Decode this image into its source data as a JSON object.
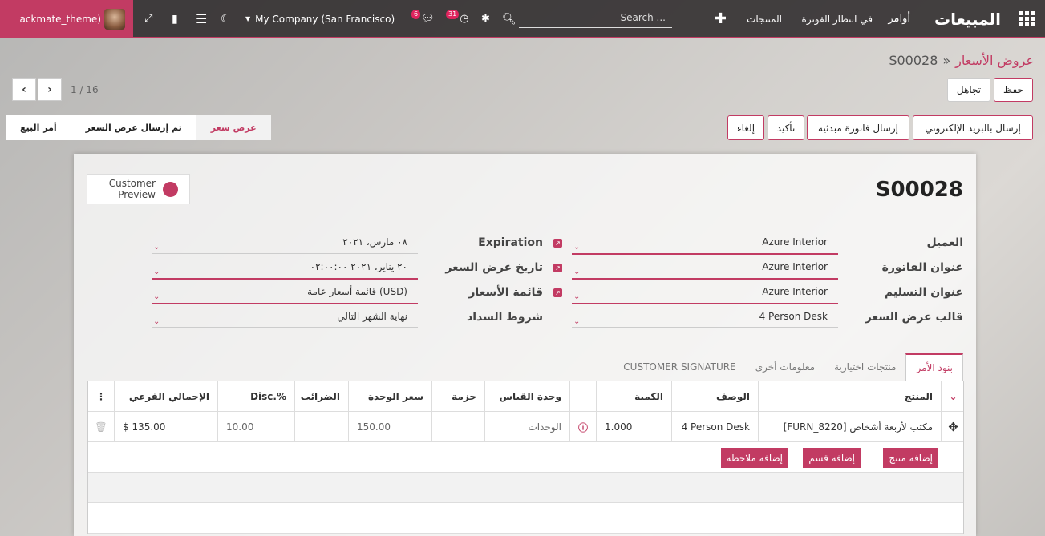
{
  "topbar": {
    "app_title": "المبيعات",
    "menu": [
      "أوامر",
      "في انتظار الفوترة",
      "المنتجات"
    ],
    "search_placeholder": "Search ...",
    "activity_count": "31",
    "chat_count": "6",
    "company": "My Company (San Francisco)",
    "username": "ackmate_theme)"
  },
  "breadcrumb": {
    "parent": "عروض الأسعار",
    "sep": "»",
    "current": "S00028"
  },
  "buttons": {
    "save": "حفظ",
    "discard": "تجاهل"
  },
  "pager": {
    "text": "1 / 16"
  },
  "actions": {
    "email": "إرسال بالبريد الإلكتروني",
    "proforma": "إرسال فاتورة مبدئية",
    "confirm": "تأكيد",
    "cancel": "إلغاء"
  },
  "stages": [
    "أمر البيع",
    "تم إرسال عرض السعر",
    "عرض سعر"
  ],
  "sheet": {
    "preview": [
      "Customer",
      "Preview"
    ],
    "name": "S00028",
    "fields_right": [
      {
        "label": "العميل",
        "value": "Azure Interior"
      },
      {
        "label": "عنوان الفاتورة",
        "value": "Azure Interior"
      },
      {
        "label": "عنوان التسليم",
        "value": "Azure Interior"
      },
      {
        "label": "قالب عرض السعر",
        "value": "4 Person Desk"
      }
    ],
    "fields_left": [
      {
        "label": "Expiration",
        "value": "٠٨ مارس، ٢٠٢١"
      },
      {
        "label": "تاريخ عرض السعر",
        "value": "٢٠ يناير، ٢٠٢١ ٠٢:٠٠:٠٠"
      },
      {
        "label": "قائمة الأسعار",
        "value": "قائمة أسعار عامة (USD)"
      },
      {
        "label": "شروط السداد",
        "value": "نهاية الشهر التالي"
      }
    ],
    "tabs": [
      "بنود الأمر",
      "منتجات اختيارية",
      "معلومات أخرى",
      "CUSTOMER SIGNATURE"
    ],
    "columns": [
      "المنتج",
      "الوصف",
      "الكمية",
      "وحدة القياس",
      "حزمة",
      "سعر الوحدة",
      "الضرائب",
      "Disc.%",
      "الإجمالي الفرعي"
    ],
    "line": {
      "product": "[FURN_8220] مكتب لأربعة أشخاص",
      "description": "4 Person Desk",
      "qty": "1.000",
      "uom": "الوحدات",
      "price": "150.00",
      "disc": "10.00",
      "subtotal": "$ 135.00"
    },
    "add": {
      "product": "إضافة منتج",
      "section": "إضافة قسم",
      "note": "إضافة ملاحظة"
    }
  }
}
